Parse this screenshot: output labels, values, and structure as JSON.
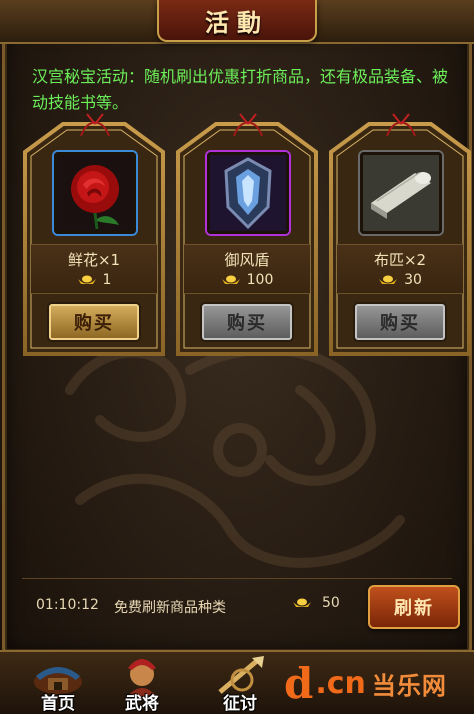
{
  "header": {
    "title": "活動"
  },
  "description": "汉宫秘宝活动：随机刷出优惠打折商品，还有极品装备、被动技能书等。",
  "items": [
    {
      "name": "鲜花×1",
      "price": "1",
      "buy_label": "购买",
      "button_state": "active",
      "icon": "rose-icon"
    },
    {
      "name": "御风盾",
      "price": "100",
      "buy_label": "购买",
      "button_state": "disabled",
      "icon": "shield-icon"
    },
    {
      "name": "布匹×2",
      "price": "30",
      "buy_label": "购买",
      "button_state": "disabled",
      "icon": "cloth-roll-icon"
    }
  ],
  "footer": {
    "timer": "01:10:12",
    "refresh_text": "免费刷新商品种类",
    "refresh_cost": "50",
    "refresh_label": "刷新"
  },
  "nav": [
    {
      "label": "首页",
      "icon": "home-icon"
    },
    {
      "label": "武将",
      "icon": "general-icon"
    },
    {
      "label": "征讨",
      "icon": "expedition-icon"
    }
  ],
  "watermark": {
    "d": "d",
    "cn": ".cn",
    "zh": "当乐网"
  },
  "colors": {
    "description": "#6cf05a",
    "title": "#ffe9b0",
    "refresh_button": "#c0501c"
  }
}
